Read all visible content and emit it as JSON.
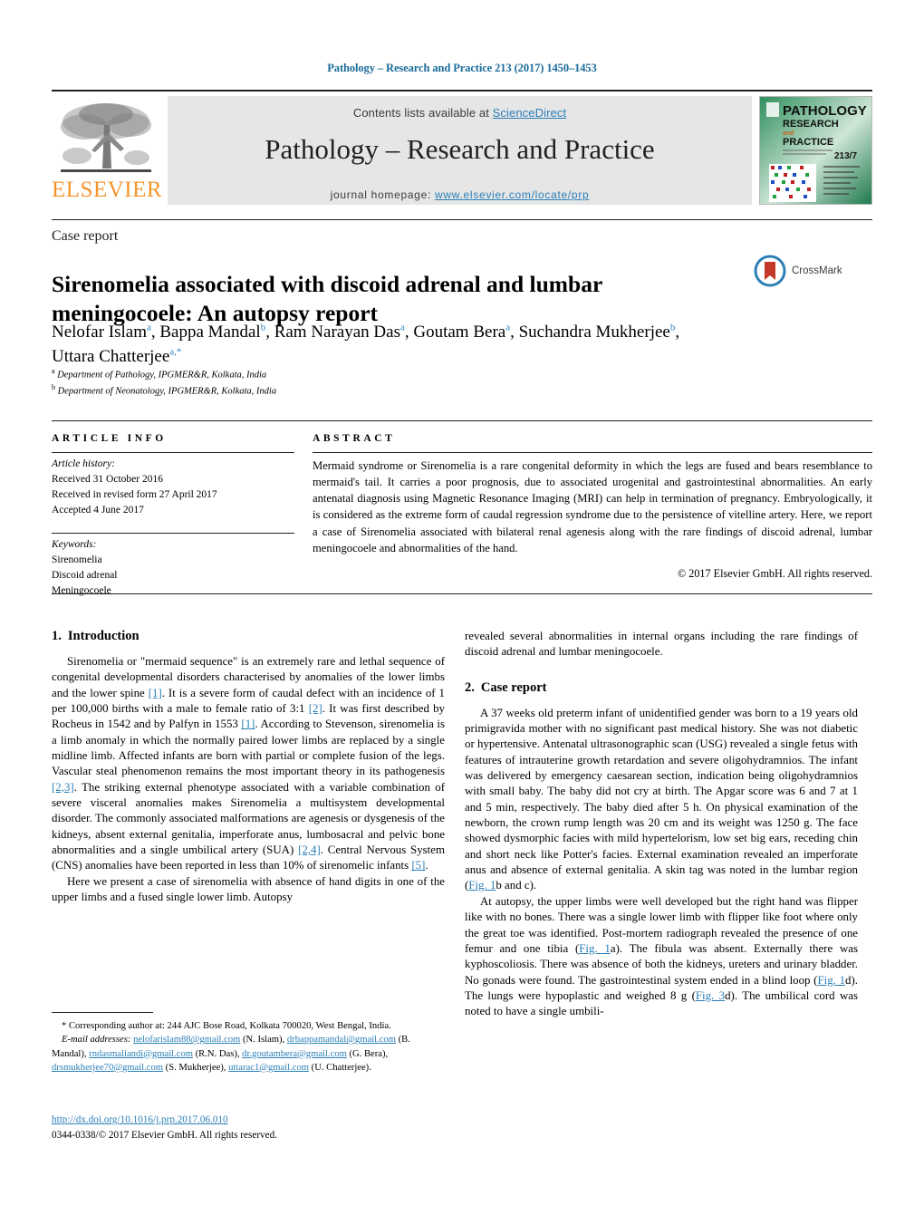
{
  "running_head": "Pathology – Research and Practice 213 (2017) 1450–1453",
  "banner": {
    "contents_prefix": "Contents lists available at ",
    "sciencedirect": "ScienceDirect",
    "journal_title": "Pathology – Research and Practice",
    "homepage_label": "journal homepage:",
    "homepage_url": "www.elsevier.com/locate/prp",
    "publisher": "ELSEVIER",
    "cover": {
      "line1": "PATHOLOGY",
      "line2": "RESEARCH",
      "line3": "and",
      "line4": "PRACTICE",
      "issue": "213/7"
    }
  },
  "article": {
    "kind": "Case report",
    "title": "Sirenomelia associated with discoid adrenal and lumbar meningocoele: An autopsy report",
    "crossmark_label": "CrossMark",
    "authors": [
      {
        "name": "Nelofar Islam",
        "marks": "a",
        "sep": ", "
      },
      {
        "name": "Bappa Mandal",
        "marks": "b",
        "sep": ", "
      },
      {
        "name": "Ram Narayan Das",
        "marks": "a",
        "sep": ", "
      },
      {
        "name": "Goutam Bera",
        "marks": "a",
        "sep": ", "
      },
      {
        "name": "Suchandra Mukherjee",
        "marks": "b",
        "sep": ", "
      },
      {
        "name": "Uttara Chatterjee",
        "marks": "a,*",
        "sep": ""
      }
    ],
    "affiliations": [
      {
        "mark": "a",
        "text": "Department of Pathology, IPGMER&R, Kolkata, India"
      },
      {
        "mark": "b",
        "text": "Department of Neonatology, IPGMER&R, Kolkata, India"
      }
    ]
  },
  "info": {
    "heading": "ARTICLE INFO",
    "history_label": "Article history:",
    "history": [
      "Received 31 October 2016",
      "Received in revised form 27 April 2017",
      "Accepted 4 June 2017"
    ],
    "keywords_label": "Keywords:",
    "keywords": [
      "Sirenomelia",
      "Discoid adrenal",
      "Meningocoele"
    ]
  },
  "abstract": {
    "heading": "ABSTRACT",
    "text": "Mermaid syndrome or Sirenomelia is a rare congenital deformity in which the legs are fused and bears resemblance to mermaid's tail. It carries a poor prognosis, due to associated urogenital and gastrointestinal abnormalities. An early antenatal diagnosis using Magnetic Resonance Imaging (MRI) can help in termination of pregnancy. Embryologically, it is considered as the extreme form of caudal regression syndrome due to the persistence of vitelline artery. Here, we report a case of Sirenomelia associated with bilateral renal agenesis along with the rare findings of discoid adrenal, lumbar meningocoele and abnormalities of the hand.",
    "copyright": "© 2017 Elsevier GmbH. All rights reserved."
  },
  "body": {
    "left": {
      "section_number": "1.",
      "section_title": "Introduction",
      "para1_a": "Sirenomelia or \"mermaid sequence\" is an extremely rare and lethal sequence of congenital developmental disorders characterised by anomalies of the lower limbs and the lower spine ",
      "ref1": "[1]",
      "para1_b": ". It is a severe form of caudal defect with an incidence of 1 per 100,000 births with a male to female ratio of 3:1 ",
      "ref2": "[2]",
      "para1_c": ". It was first described by Rocheus in 1542 and by Palfyn in 1553 ",
      "ref3": "[1]",
      "para1_d": ". According to Stevenson, sirenomelia is a limb anomaly in which the normally paired lower limbs are replaced by a single midline limb. Affected infants are born with partial or complete fusion of the legs. Vascular steal phenomenon remains the most important theory in its pathogenesis ",
      "ref4": "[2,3]",
      "para1_e": ". The striking external phenotype associated with a variable combination of severe visceral anomalies makes Sirenomelia a multisystem developmental disorder. The commonly associated malformations are agenesis or dysgenesis of the kidneys, absent external genitalia, imperforate anus, lumbosacral and pelvic bone abnormalities and a single umbilical artery (SUA) ",
      "ref5": "[2,4]",
      "para1_f": ". Central Nervous System (CNS) anomalies have been reported in less than 10% of sirenomelic infants ",
      "ref6": "[5]",
      "para1_g": ".",
      "para2": "Here we present a case of sirenomelia with absence of hand digits in one of the upper limbs and a fused single lower limb. Autopsy"
    },
    "right": {
      "para_cont": "revealed several abnormalities in internal organs including the rare findings of discoid adrenal and lumbar meningocoele.",
      "section_number": "2.",
      "section_title": "Case report",
      "para1_a": "A 37 weeks old preterm infant of unidentified gender was born to a 19 years old primigravida mother with no significant past medical history. She was not diabetic or hypertensive. Antenatal ultrasonographic scan (USG) revealed a single fetus with features of intrauterine growth retardation and severe oligohydramnios. The infant was delivered by emergency caesarean section, indication being oligohydramnios with small baby. The baby did not cry at birth. The Apgar score was 6 and 7 at 1 and 5 min, respectively. The baby died after 5 h. On physical examination of the newborn, the crown rump length was 20 cm and its weight was 1250 g. The face showed dysmorphic facies with mild hypertelorism, low set big ears, receding chin and short neck like Potter's facies. External examination revealed an imperforate anus and absence of external genitalia. A skin tag was noted in the lumbar region (",
      "figref1": "Fig. 1",
      "para1_b": "b and c).",
      "para2_a": "At autopsy, the upper limbs were well developed but the right hand was flipper like with no bones. There was a single lower limb with flipper like foot where only the great toe was identified. Post-mortem radiograph revealed the presence of one femur and one tibia (",
      "figref2": "Fig. 1",
      "para2_b": "a). The fibula was absent. Externally there was kyphoscoliosis. There was absence of both the kidneys, ureters and urinary bladder. No gonads were found. The gastrointestinal system ended in a blind loop (",
      "figref3": "Fig. 1",
      "para2_c": "d). The lungs were hypoplastic and weighed 8 g (",
      "figref4": "Fig. 3",
      "para2_d": "d). The umbilical cord was noted to have a single umbili-"
    }
  },
  "footnote": {
    "star": "*",
    "corresponding": " Corresponding author at: 244 AJC Bose Road, Kolkata 700020, West Bengal, India.",
    "email_label": "E-mail addresses:",
    "emails": [
      {
        "address": "nelofarislam88@gmail.com",
        "owner": " (N. Islam),"
      },
      {
        "address": "drbappamandal@gmail.com",
        "owner": " (B. Mandal),"
      },
      {
        "address": "rndasmaliandi@gmail.com",
        "owner": " (R.N. Das),"
      },
      {
        "address": "dr.goutambera@gmail.com",
        "owner": " (G. Bera),"
      },
      {
        "address": "drsmukherjee70@gmail.com",
        "owner": " (S. Mukherjee),"
      },
      {
        "address": "uttarac1@gmail.com",
        "owner": " (U. Chatterjee)."
      }
    ],
    "doi": "http://dx.doi.org/10.1016/j.prp.2017.06.010",
    "issn_line": "0344-0338/© 2017 Elsevier GmbH. All rights reserved."
  },
  "colors": {
    "link": "#2a7fb8",
    "elsevier_orange": "#f3952b",
    "banner_grey": "#e6e6e6",
    "cover_green": "#1f7a4d",
    "crossmark_blue": "#2e7fb5",
    "crossmark_red": "#c4382a"
  }
}
